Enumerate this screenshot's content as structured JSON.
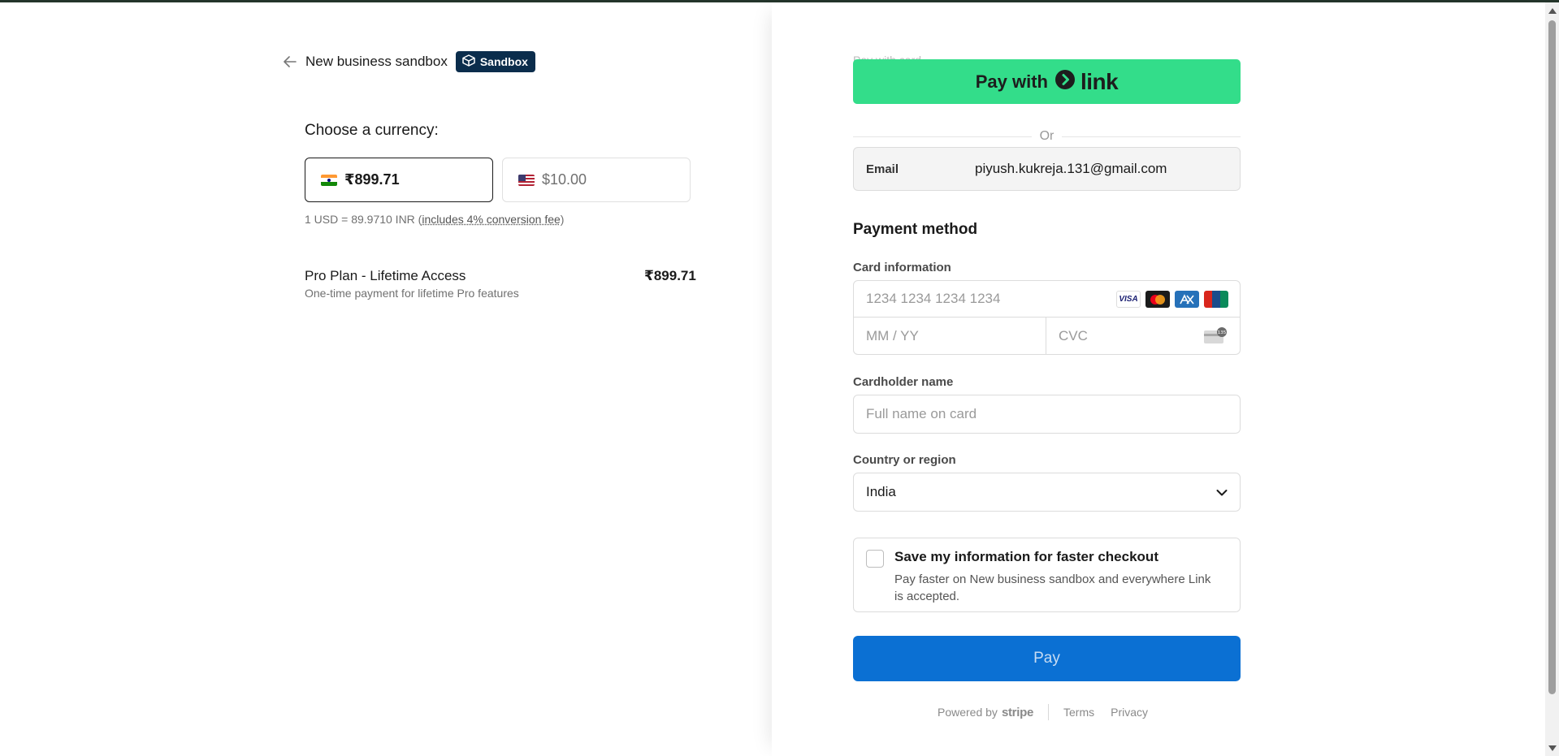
{
  "header": {
    "business_name": "New business sandbox",
    "badge": "Sandbox"
  },
  "currency": {
    "heading": "Choose a currency:",
    "options": [
      {
        "flag": "india-flag-icon",
        "value": "₹899.71",
        "selected": true
      },
      {
        "flag": "us-flag-icon",
        "value": "$10.00",
        "selected": false
      }
    ],
    "rate_prefix": "1 USD = 89.9710 INR (",
    "rate_fee": "includes 4% conversion fee",
    "rate_suffix": ")"
  },
  "product": {
    "name": "Pro Plan - Lifetime Access",
    "description": "One-time payment for lifetime Pro features",
    "price": "₹899.71"
  },
  "checkout": {
    "faded_text": "Pay with card",
    "link_button": {
      "prefix": "Pay with",
      "brand": "link"
    },
    "or_label": "Or",
    "email_label": "Email",
    "email_value": "piyush.kukreja.131@gmail.com",
    "payment_method_heading": "Payment method",
    "card_info_label": "Card information",
    "card_number_placeholder": "1234 1234 1234 1234",
    "expiry_placeholder": "MM / YY",
    "cvc_placeholder": "CVC",
    "card_brands": [
      "VISA",
      "Mastercard",
      "AMEX",
      "UnionPay"
    ],
    "cvc_hint": "135",
    "cardholder_label": "Cardholder name",
    "cardholder_placeholder": "Full name on card",
    "country_label": "Country or region",
    "country_value": "India",
    "save_title": "Save my information for faster checkout",
    "save_description": "Pay faster on New business sandbox and everywhere Link is accepted.",
    "pay_label": "Pay"
  },
  "footer": {
    "powered_by": "Powered by",
    "stripe": "stripe",
    "terms": "Terms",
    "privacy": "Privacy"
  },
  "colors": {
    "link_green": "#33dd8a",
    "pay_blue": "#0b70d3",
    "badge_navy": "#0b2d4c"
  }
}
